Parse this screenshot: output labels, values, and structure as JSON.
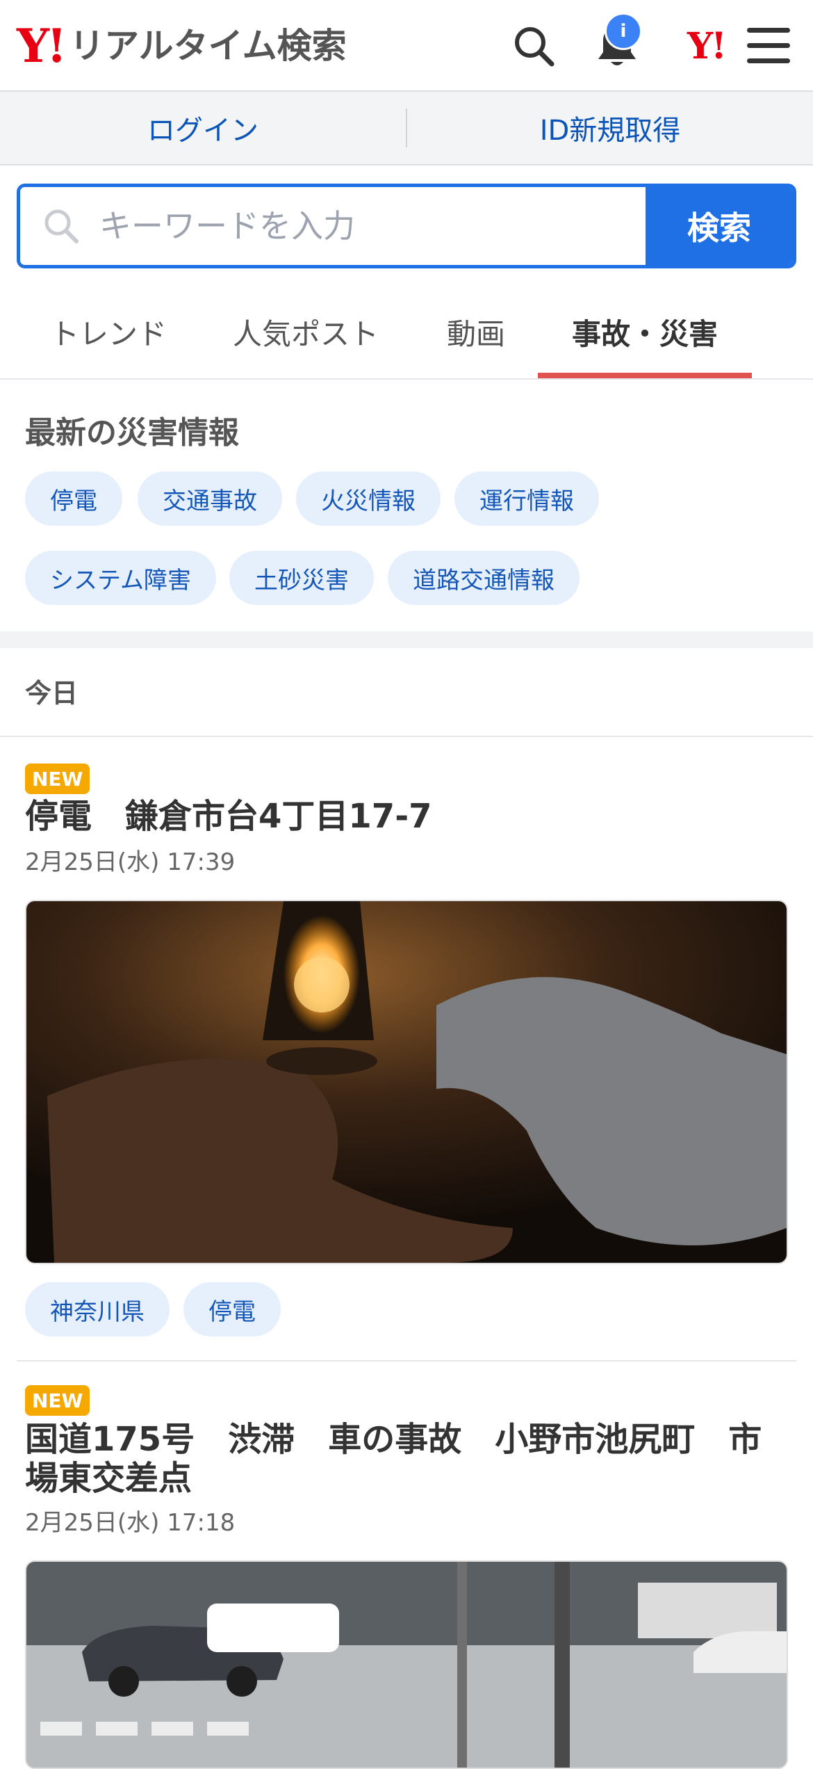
{
  "header": {
    "logo_mark": "Y!",
    "logo_title": "リアルタイム検索",
    "notification_badge": "i",
    "yj_logo": "Y!"
  },
  "auth": {
    "login": "ログイン",
    "register": "ID新規取得"
  },
  "search": {
    "placeholder": "キーワードを入力",
    "button": "検索"
  },
  "tabs": [
    {
      "label": "トレンド",
      "active": false
    },
    {
      "label": "人気ポスト",
      "active": false
    },
    {
      "label": "動画",
      "active": false
    },
    {
      "label": "事故・災害",
      "active": true
    }
  ],
  "disaster": {
    "heading": "最新の災害情報",
    "chips": [
      "停電",
      "交通事故",
      "火災情報",
      "運行情報",
      "システム障害",
      "土砂災害",
      "道路交通情報"
    ]
  },
  "feed": {
    "section_label": "今日",
    "posts": [
      {
        "badge": "NEW",
        "title": "停電　鎌倉市台4丁目17-7",
        "date": "2月25日(水) 17:39",
        "tags": [
          "神奈川県",
          "停電"
        ]
      },
      {
        "badge": "NEW",
        "title": "国道175号　渋滞　車の事故　小野市池尻町　市場東交差点",
        "date": "2月25日(水) 17:18"
      }
    ]
  },
  "colors": {
    "brand_red": "#e60012",
    "accent_blue": "#1f6fe5",
    "chip_bg": "#e6f0fc",
    "chip_text": "#1457b8",
    "tab_indicator": "#e0534f",
    "new_badge": "#f5a800"
  },
  "icons": {
    "search": "search-icon",
    "bell": "bell-icon",
    "menu": "hamburger-menu-icon"
  }
}
